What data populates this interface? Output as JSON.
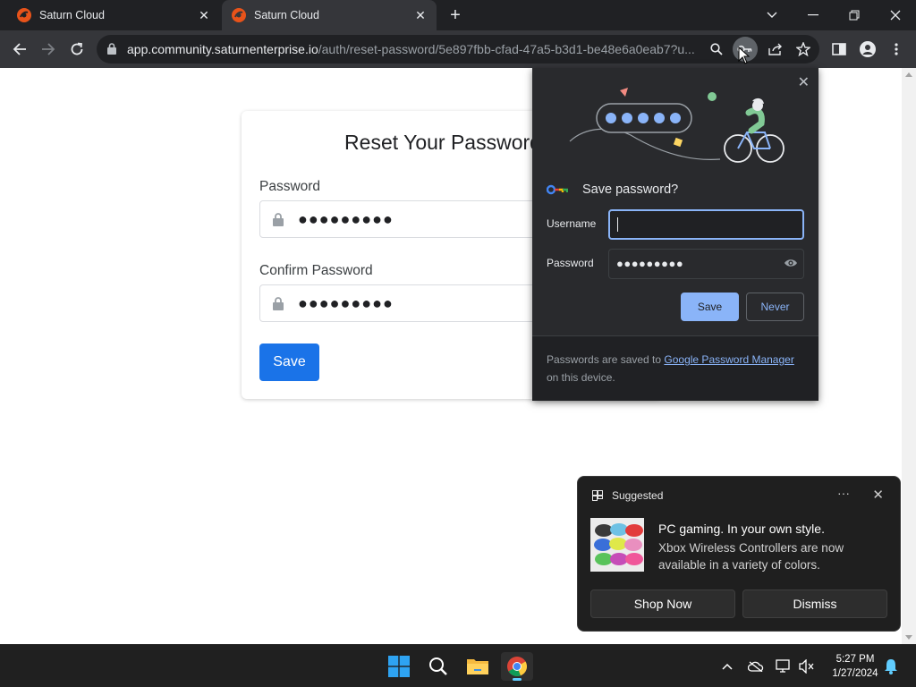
{
  "browser": {
    "tabs": [
      {
        "title": "Saturn Cloud",
        "active": false
      },
      {
        "title": "Saturn Cloud",
        "active": true
      }
    ],
    "url": {
      "host": "app.community.saturnenterprise.io",
      "path": "/auth/reset-password/5e897fbb-cfad-47a5-b3d1-be48e6a0eab7?u..."
    }
  },
  "page": {
    "title": "Reset Your Password",
    "password_label": "Password",
    "password_value": "●●●●●●●●●",
    "confirm_label": "Confirm Password",
    "confirm_value": "●●●●●●●●●",
    "save_label": "Save"
  },
  "save_password_bubble": {
    "heading": "Save password?",
    "username_label": "Username",
    "username_value": "",
    "password_label": "Password",
    "password_value": "●●●●●●●●●",
    "save_label": "Save",
    "never_label": "Never",
    "footer_prefix": "Passwords are saved to",
    "footer_link": "Google Password Manager",
    "footer_suffix": "on this device."
  },
  "notification": {
    "header": "Suggested",
    "more": "···",
    "title": "PC gaming. In your own style.",
    "body": "Xbox Wireless Controllers are now available in a variety of colors.",
    "primary_action": "Shop Now",
    "secondary_action": "Dismiss"
  },
  "taskbar": {
    "time": "5:27 PM",
    "date": "1/27/2024"
  },
  "colors": {
    "accent_blue": "#1a73e8",
    "bubble_accent": "#8ab4f8",
    "brand_orange": "#e8531a"
  }
}
